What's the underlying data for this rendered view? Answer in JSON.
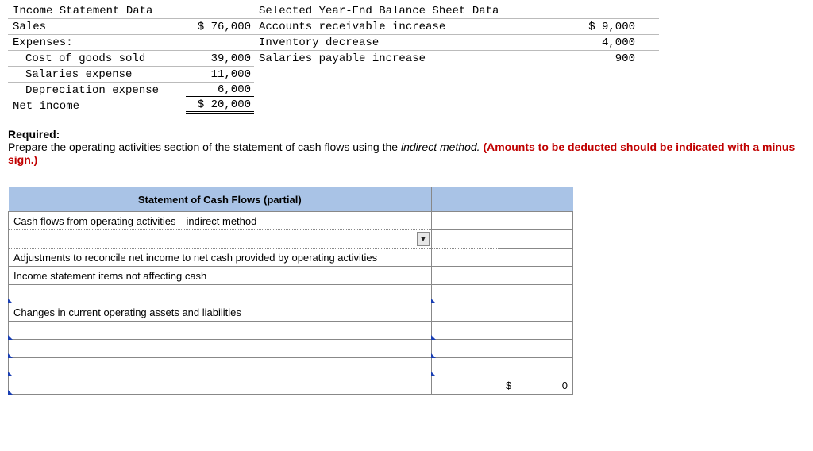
{
  "income": {
    "header": "Income Statement Data",
    "sales_label": "Sales",
    "sales_value": "$ 76,000",
    "expenses_label": "Expenses:",
    "cogs_label": "Cost of goods sold",
    "cogs_value": "39,000",
    "salaries_label": "Salaries expense",
    "salaries_value": "11,000",
    "depr_label": "Depreciation expense",
    "depr_value": "6,000",
    "net_income_label": "Net income",
    "net_income_value": "$ 20,000"
  },
  "balance": {
    "header": "Selected Year-End Balance Sheet Data",
    "ar_label": "Accounts receivable increase",
    "ar_value": "$ 9,000",
    "inv_label": "Inventory decrease",
    "inv_value": "4,000",
    "sal_pay_label": "Salaries payable increase",
    "sal_pay_value": "900"
  },
  "required": {
    "title": "Required:",
    "body_a": "Prepare the operating activities section of the statement of cash flows using the ",
    "body_ital": "indirect method.",
    "body_red": " (Amounts to be deducted should be indicated with a minus sign.)"
  },
  "cashflow": {
    "title": "Statement of Cash Flows (partial)",
    "r1": "Cash flows from operating activities—indirect method",
    "r3": "Adjustments to reconcile net income to net cash provided by operating activities",
    "r4": "Income statement items not affecting cash",
    "r6": "Changes in current operating assets and liabilities",
    "total_prefix": "$",
    "total_value": "0"
  }
}
